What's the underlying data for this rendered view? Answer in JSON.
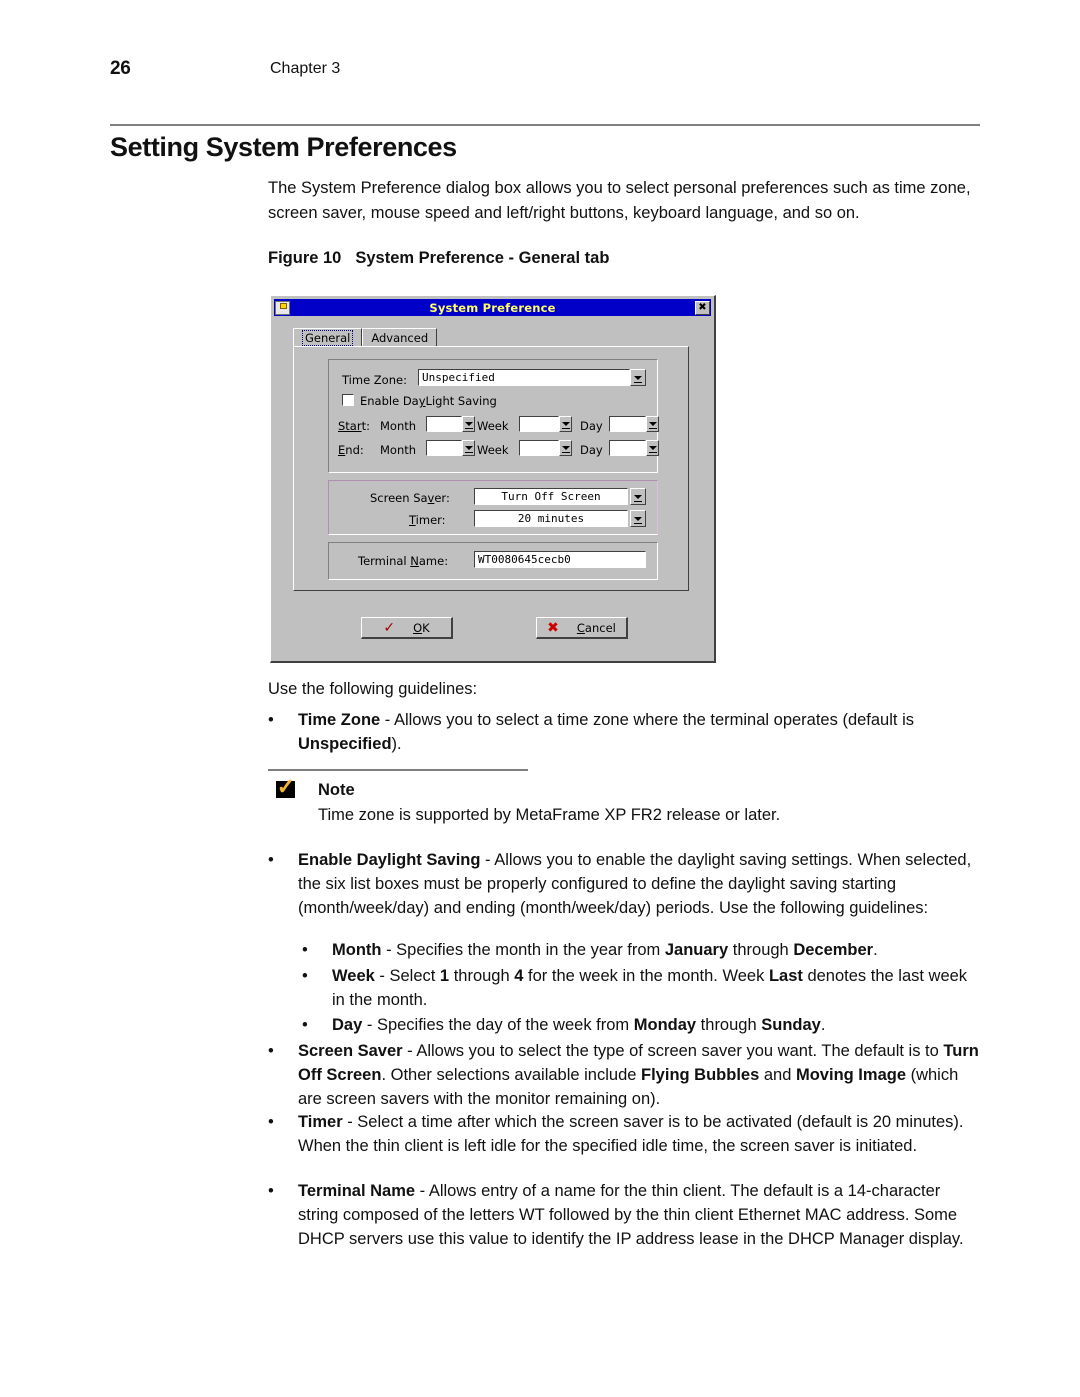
{
  "page": {
    "number": "26",
    "chapter": "Chapter 3",
    "section_title": "Setting System Preferences",
    "intro": "The System Preference dialog box allows you to select personal preferences such as time zone, screen saver, mouse speed and left/right buttons, keyboard language, and so on.",
    "figure_label": "Figure 10",
    "figure_title": "System Preference - General tab",
    "guidelines_lead": "Use the following guidelines:"
  },
  "dialog": {
    "title": "System Preference",
    "icon": "document-icon",
    "close_label": "✖",
    "tabs": [
      {
        "label": "General",
        "active": true
      },
      {
        "label": "Advanced",
        "active": false
      }
    ],
    "time_zone_label": "Time Zone:",
    "time_zone_value": "Unspecified",
    "daylight_checkbox_label": "Enable DayLight Saving",
    "daylight_checked": false,
    "start_label": "Start:",
    "end_label": "End:",
    "month_label": "Month",
    "week_label": "Week",
    "day_label": "Day",
    "start_month_value": "",
    "start_week_value": "",
    "start_day_value": "",
    "end_month_value": "",
    "end_week_value": "",
    "end_day_value": "",
    "screen_saver_label": "Screen Saver:",
    "screen_saver_value": "Turn Off Screen",
    "timer_label": "Timer:",
    "timer_value": "20 minutes",
    "terminal_name_label": "Terminal Name:",
    "terminal_name_value": "WT0080645cecb0",
    "ok_label": "OK",
    "cancel_label": "Cancel",
    "colors": {
      "titlebar": "#0000c8",
      "titlebar_text": "#ffff66",
      "face": "#c0c0c0",
      "ok_mark": "#a00000",
      "cancel_mark": "#cc0000"
    }
  },
  "bullets": {
    "time_zone": {
      "term": "Time Zone",
      "text_a": " - Allows you to select a time zone where the terminal operates (default is ",
      "term_b": "Unspecified",
      "text_b": ")."
    },
    "note": {
      "title": "Note",
      "icon": "checkmark-note-icon",
      "body": "Time zone is supported by MetaFrame XP FR2 release or later."
    },
    "daylight": {
      "term": "Enable Daylight Saving",
      "text": " - Allows you to enable the daylight saving settings. When selected, the six list boxes must be properly configured to define the daylight saving starting (month/week/day) and ending (month/week/day) periods. Use the following guidelines:"
    },
    "month": {
      "term": "Month",
      "text_a": " - Specifies the month in the year from ",
      "term_b": "January",
      "text_b": " through ",
      "term_c": "December",
      "text_c": "."
    },
    "week": {
      "term": "Week",
      "text_a": " - Select ",
      "term_b": "1",
      "text_b": " through ",
      "term_c": "4",
      "text_c": " for the week in the month. Week ",
      "term_d": "Last",
      "text_d": " denotes the last week in the month."
    },
    "day": {
      "term": "Day",
      "text_a": " - Specifies the day of the week from ",
      "term_b": "Monday",
      "text_b": " through ",
      "term_c": "Sunday",
      "text_c": "."
    },
    "screen_saver": {
      "term": "Screen Saver",
      "text_a": " - Allows you to select the type of screen saver you want. The default is to ",
      "term_b": "Turn Off Screen",
      "text_b": ". Other selections available include ",
      "term_c": "Flying Bubbles",
      "text_c": " and ",
      "term_d": "Moving Image",
      "text_d": " (which are screen savers with the monitor remaining on)."
    },
    "timer": {
      "term": "Timer",
      "text": " - Select a time after which the screen saver is to be activated (default is 20 minutes). When the thin client is left idle for the specified idle time, the screen saver is initiated."
    },
    "terminal_name": {
      "term": "Terminal Name",
      "text": " - Allows entry of a name for the thin client. The default is a 14-character string composed of the letters WT followed by the thin client Ethernet MAC address. Some DHCP servers use this value to identify the IP address lease in the DHCP Manager display."
    }
  }
}
